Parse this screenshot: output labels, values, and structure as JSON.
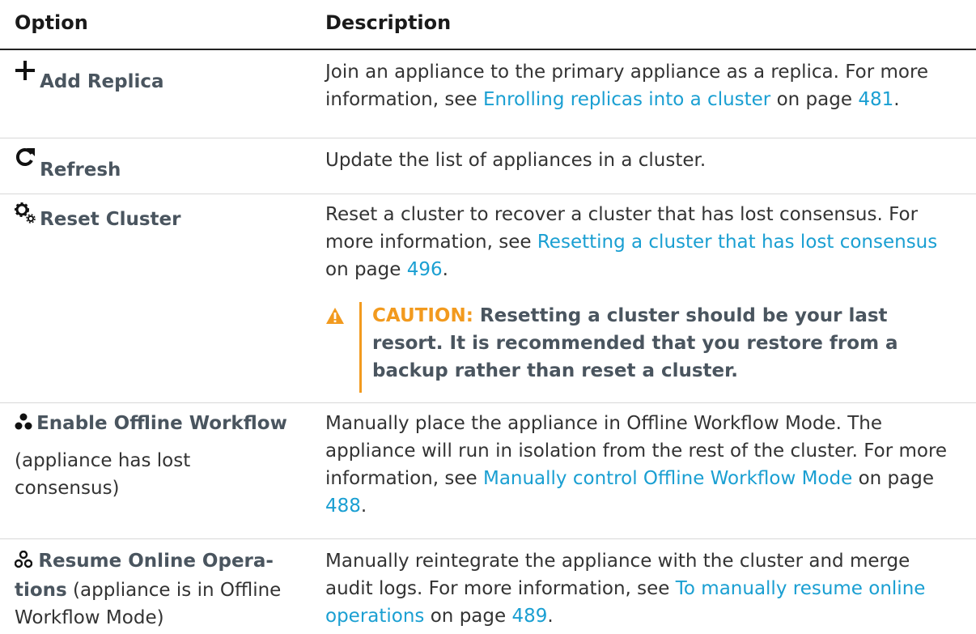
{
  "header": {
    "option": "Option",
    "description": "Description"
  },
  "rows": [
    {
      "icon": "plus-icon",
      "name": "Add Replica",
      "desc_pre": "Join an appliance to the primary appliance as a replica. For more information, see ",
      "link": "Enrolling replicas into a cluster",
      "mid": " on page ",
      "page": "481",
      "end": "."
    },
    {
      "icon": "refresh-icon",
      "name": "Refresh",
      "desc_pre": "Update the list of appliances in a cluster."
    },
    {
      "icon": "gears-icon",
      "name": "Reset Cluster",
      "desc_pre": "Reset a cluster to recover a cluster that has lost consensus. For more information, see ",
      "link": "Resetting a cluster that has lost consensus",
      "mid": " on page ",
      "page": "496",
      "end": ".",
      "caution_label": "CAUTION:",
      "caution_text": " Resetting a cluster should be your last resort. It is recommended that you restore from a backup rather than reset a cluster."
    },
    {
      "icon": "cluster-icon",
      "name": "Enable Offline Workflow",
      "note": "(appliance has lost consensus)",
      "desc_pre": "Manually place the appliance in Offline Workflow Mode. The appliance will run in isolation from the rest of the cluster. For more information, see ",
      "link": "Manually control Offline Workflow Mode",
      "mid": " on page ",
      "page": "488",
      "end": "."
    },
    {
      "icon": "cluster-outline-icon",
      "name": "Resume Online Opera- tions",
      "note": " (appliance is in Offline Workflow Mode)",
      "desc_pre": "Manually reintegrate the appliance with the cluster and merge audit logs. For more information, see ",
      "link": "To manually resume online operations",
      "mid": " on page ",
      "page": "489",
      "end": "."
    }
  ],
  "colors": {
    "link": "#1a9fd2",
    "caution": "#f29a1e",
    "option_text": "#4a555f"
  }
}
